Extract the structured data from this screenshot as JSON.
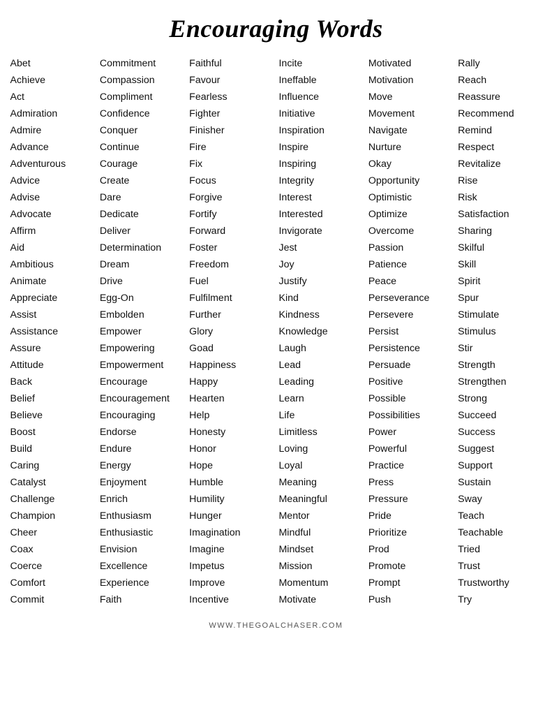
{
  "title": "Encouraging Words",
  "footer": "WWW.THEGOALCHASER.COM",
  "columns": [
    [
      "Abet",
      "Achieve",
      "Act",
      "Admiration",
      "Admire",
      "Advance",
      "Adventurous",
      "Advice",
      "Advise",
      "Advocate",
      "Affirm",
      "Aid",
      "Ambitious",
      "Animate",
      "Appreciate",
      "Assist",
      "Assistance",
      "Assure",
      "Attitude",
      "Back",
      "Belief",
      "Believe",
      "Boost",
      "Build",
      "Caring",
      "Catalyst",
      "Challenge",
      "Champion",
      "Cheer",
      "Coax",
      "Coerce",
      "Comfort",
      "Commit"
    ],
    [
      "Commitment",
      "Compassion",
      "Compliment",
      "Confidence",
      "Conquer",
      "Continue",
      "Courage",
      "Create",
      "Dare",
      "Dedicate",
      "Deliver",
      "Determination",
      "Dream",
      "Drive",
      "Egg-On",
      "Embolden",
      "Empower",
      "Empowering",
      "Empowerment",
      "Encourage",
      "Encouragement",
      "Encouraging",
      "Endorse",
      "Endure",
      "Energy",
      "Enjoyment",
      "Enrich",
      "Enthusiasm",
      "Enthusiastic",
      "Envision",
      "Excellence",
      "Experience",
      "Faith"
    ],
    [
      "Faithful",
      "Favour",
      "Fearless",
      "Fighter",
      "Finisher",
      "Fire",
      "Fix",
      "Focus",
      "Forgive",
      "Fortify",
      "Forward",
      "Foster",
      "Freedom",
      "Fuel",
      "Fulfilment",
      "Further",
      "Glory",
      "Goad",
      "Happiness",
      "Happy",
      "Hearten",
      "Help",
      "Honesty",
      "Honor",
      "Hope",
      "Humble",
      "Humility",
      "Hunger",
      "Imagination",
      "Imagine",
      "Impetus",
      "Improve",
      "Incentive"
    ],
    [
      "Incite",
      "Ineffable",
      "Influence",
      "Initiative",
      "Inspiration",
      "Inspire",
      "Inspiring",
      "Integrity",
      "Interest",
      "Interested",
      "Invigorate",
      "Jest",
      "Joy",
      "Justify",
      "Kind",
      "Kindness",
      "Knowledge",
      "Laugh",
      "Lead",
      "Leading",
      "Learn",
      "Life",
      "Limitless",
      "Loving",
      "Loyal",
      "Meaning",
      "Meaningful",
      "Mentor",
      "Mindful",
      "Mindset",
      "Mission",
      "Momentum",
      "Motivate"
    ],
    [
      "Motivated",
      "Motivation",
      "Move",
      "Movement",
      "Navigate",
      "Nurture",
      "Okay",
      "Opportunity",
      "Optimistic",
      "Optimize",
      "Overcome",
      "Passion",
      "Patience",
      "Peace",
      "Perseverance",
      "Persevere",
      "Persist",
      "Persistence",
      "Persuade",
      "Positive",
      "Possible",
      "Possibilities",
      "Power",
      "Powerful",
      "Practice",
      "Press",
      "Pressure",
      "Pride",
      "Prioritize",
      "Prod",
      "Promote",
      "Prompt",
      "Push"
    ],
    [
      "Rally",
      "Reach",
      "Reassure",
      "Recommend",
      "Remind",
      "Respect",
      "Revitalize",
      "Rise",
      "Risk",
      "Satisfaction",
      "Sharing",
      "Skilful",
      "Skill",
      "Spirit",
      "Spur",
      "Stimulate",
      "Stimulus",
      "Stir",
      "Strength",
      "Strengthen",
      "Strong",
      "Succeed",
      "Success",
      "Suggest",
      "Support",
      "Sustain",
      "Sway",
      "Teach",
      "Teachable",
      "Tried",
      "Trust",
      "Trustworthy",
      "Try"
    ]
  ]
}
